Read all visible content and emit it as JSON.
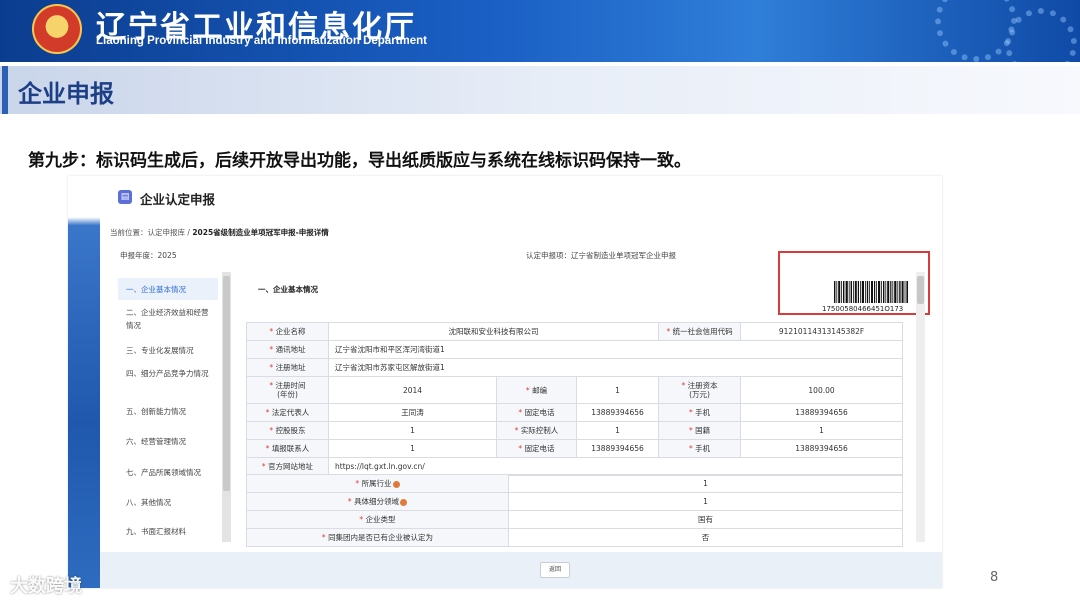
{
  "banner": {
    "title": "辽宁省工业和信息化厅",
    "subtitle": "Liaoning Provincial Industry and Informatization Department"
  },
  "section_title": "企业申报",
  "step_text": "第九步：标识码生成后，后续开放导出功能，导出纸质版应与系统在线标识码保持一致。",
  "app": {
    "title": "企业认定申报",
    "breadcrumb_prefix": "当前位置：认定申报库 /",
    "breadcrumb_current": "2025省级制造业单项冠军申报-申报详情",
    "report_year": "申报年度：2025",
    "report_category": "认定申报项：辽宁省制造业单项冠军企业申报",
    "content_heading": "一、企业基本情况",
    "barcode_number": "17500580466451O173",
    "back_label": "返回",
    "nav": [
      "一、企业基本情况",
      "二、企业经济效益和经营情况",
      "三、专业化发展情况",
      "四、细分产品竞争力情况",
      "五、创新能力情况",
      "六、经营管理情况",
      "七、产品所属领域情况",
      "八、其他情况",
      "九、书面汇报材料"
    ],
    "form": {
      "company_name_label": "企业名称",
      "company_name": "沈阳联和安业科技有限公司",
      "credit_code_label": "统一社会信用代码",
      "credit_code": "91210114313145382F",
      "mail_addr_label": "通讯地址",
      "mail_addr": "辽宁省沈阳市和平区浑河湾街道1",
      "reg_addr_label": "注册地址",
      "reg_addr": "辽宁省沈阳市苏家屯区解放街道1",
      "reg_time_label": "注册时间\n(年份)",
      "reg_time": "2014",
      "postcode_label": "邮编",
      "postcode": "1",
      "reg_capital_label": "注册资本\n(万元)",
      "reg_capital": "100.00",
      "legal_rep_label": "法定代表人",
      "legal_rep": "王同涛",
      "phone_label": "固定电话",
      "phone": "13889394656",
      "mobile_label": "手机",
      "mobile": "13889394656",
      "holding_label": "控股股东",
      "holding": "1",
      "controller_label": "实际控制人",
      "controller": "1",
      "nationality_label": "国籍",
      "nationality": "1",
      "contact_label": "填报联系人",
      "contact": "1",
      "phone2_label": "固定电话",
      "phone2": "13889394656",
      "mobile2_label": "手机",
      "mobile2": "13889394656",
      "website_label": "官方网站地址",
      "website": "https://lqt.gxt.ln.gov.cn/",
      "industry_label": "所属行业",
      "industry": "1",
      "subfield_label": "具体细分领域",
      "subfield": "1",
      "type_label": "企业类型",
      "type": "国有",
      "group_label": "同集团内是否已有企业被认定为",
      "group": "否"
    }
  },
  "page_number": "8",
  "watermark": "大数跨境"
}
